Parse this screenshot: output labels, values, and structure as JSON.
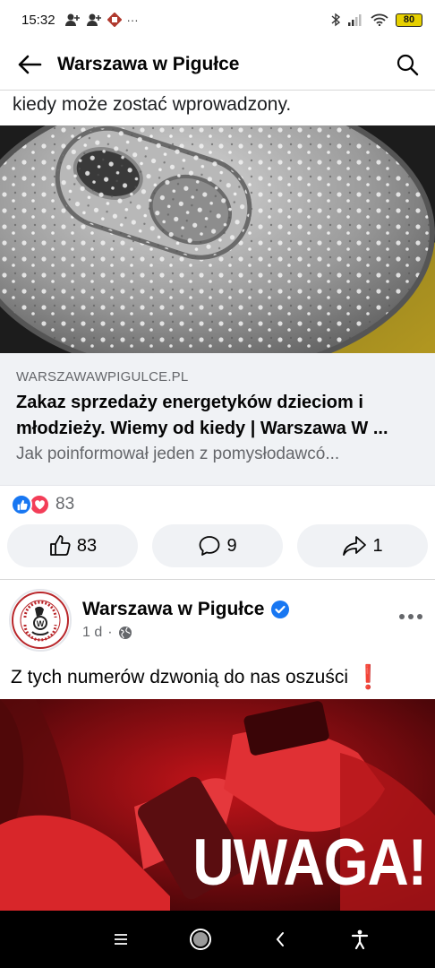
{
  "status_bar": {
    "time": "15:32",
    "more_dots": "···",
    "battery": "80"
  },
  "header": {
    "title": "Warszawa w Pigułce"
  },
  "previous_post": {
    "cut_text": "kiedy może zostać wprowadzony.",
    "link": {
      "domain": "WARSZAWAWPIGULCE.PL",
      "title": "Zakaz sprzedaży energetyków dzieciom i młodzieży. Wiemy od kiedy | Warszawa W ...",
      "description": "Jak poinformował jeden z pomysłodawcó..."
    },
    "reactions_count": "83",
    "actions": {
      "like_count": "83",
      "comment_count": "9",
      "share_count": "1"
    }
  },
  "post": {
    "author": "Warszawa w Pigułce",
    "time": "1 d",
    "separator": "·",
    "text": "Z tych numerów dzwonią do nas oszuści",
    "emoji": "❗",
    "image_overlay_text": "UWAGA!",
    "logo_text": "WARSZAWA W PIGUŁCE"
  },
  "colors": {
    "accent": "#1877f2",
    "love": "#f33e58",
    "gray_bg": "#f0f2f5",
    "muted_text": "#65676b"
  },
  "icons": {
    "back": "arrow-left-icon",
    "search": "search-icon",
    "like": "thumbs-up-icon",
    "comment": "comment-icon",
    "share": "share-icon",
    "more": "more-horizontal-icon",
    "globe": "globe-icon",
    "verified": "verified-badge-icon"
  }
}
